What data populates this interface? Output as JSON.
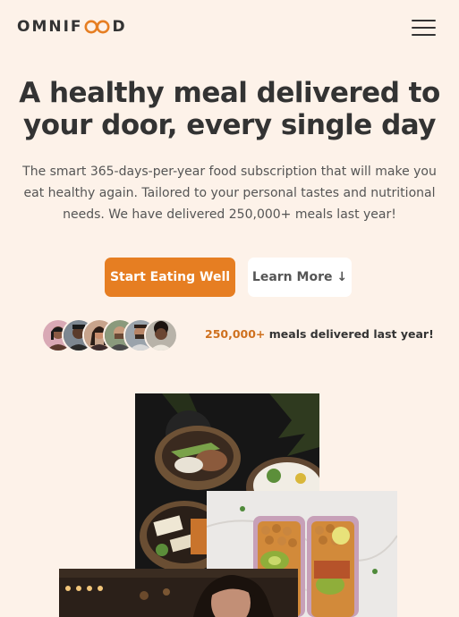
{
  "header": {
    "logo_before": "OMNIF",
    "logo_after": "D",
    "menu_icon": "hamburger-menu-icon"
  },
  "hero": {
    "title": "A healthy meal delivered to your door, every single day",
    "description": "The smart 365-days-per-year food subscription that will make you eat healthy again. Tailored to your personal tastes and nutritional needs. We have delivered 250,000+ meals last year!",
    "primary_cta": "Start Eating Well",
    "secondary_cta": "Learn More ↓"
  },
  "delivered": {
    "count": "250,000+",
    "text": " meals delivered last year!"
  },
  "colors": {
    "background": "#fdf2e9",
    "accent": "#e67e22",
    "accent_dark": "#cf711f",
    "text": "#333333"
  }
}
